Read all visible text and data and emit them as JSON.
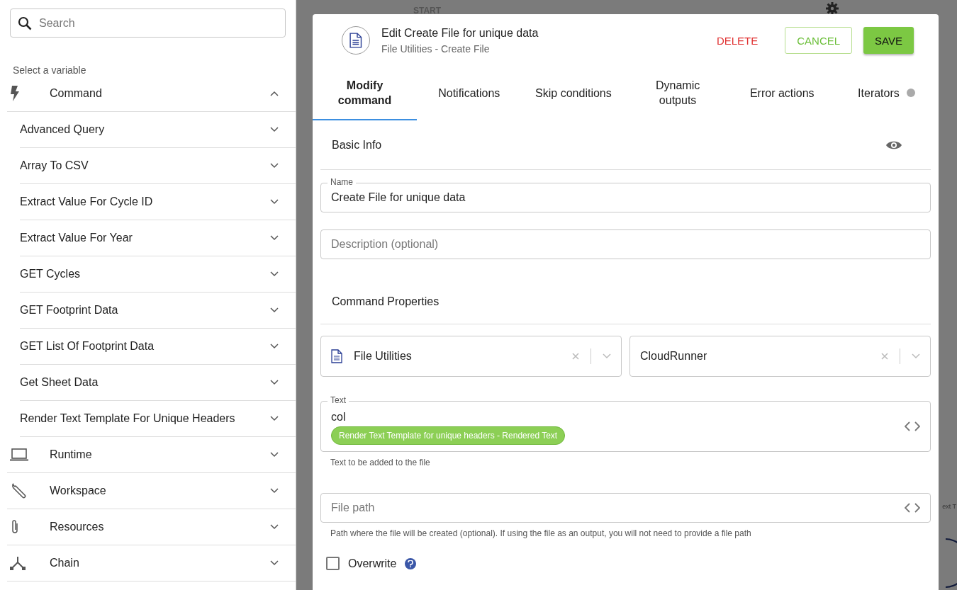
{
  "background": {
    "top_label": "START",
    "side_label": "ext T"
  },
  "sidebar": {
    "search": {
      "placeholder": "Search"
    },
    "hint": "Select a variable",
    "sections": [
      {
        "kind": "command",
        "label": "Command",
        "expanded": true,
        "children": [
          {
            "label": "Advanced Query",
            "expanded": false
          },
          {
            "label": "Array To CSV",
            "expanded": false
          },
          {
            "label": "Extract Value For Cycle ID",
            "expanded": false
          },
          {
            "label": "Extract Value For Year",
            "expanded": false
          },
          {
            "label": "GET Cycles",
            "expanded": false
          },
          {
            "label": "GET Footprint Data",
            "expanded": false
          },
          {
            "label": "GET List Of Footprint Data",
            "expanded": false
          },
          {
            "label": "Get Sheet Data",
            "expanded": false
          },
          {
            "label": "Render Text Template For Unique Headers",
            "expanded": false
          }
        ]
      },
      {
        "kind": "runtime",
        "label": "Runtime",
        "expanded": false
      },
      {
        "kind": "workspace",
        "label": "Workspace",
        "expanded": false
      },
      {
        "kind": "resources",
        "label": "Resources",
        "expanded": false
      },
      {
        "kind": "chain",
        "label": "Chain",
        "expanded": false
      }
    ]
  },
  "modal": {
    "title": "Edit Create File for unique data",
    "subtitle": "File Utilities - Create File",
    "buttons": {
      "delete": "DELETE",
      "cancel": "CANCEL",
      "save": "SAVE"
    },
    "tabs": [
      {
        "label": "Modify command",
        "selected": true
      },
      {
        "label": "Notifications",
        "selected": false
      },
      {
        "label": "Skip conditions",
        "selected": false
      },
      {
        "label": "Dynamic outputs",
        "selected": false
      },
      {
        "label": "Error actions",
        "selected": false
      },
      {
        "label": "Iterators",
        "selected": false,
        "dot": true
      }
    ],
    "basic_info": {
      "heading": "Basic Info",
      "name": {
        "label": "Name",
        "value": "Create File for unique data"
      },
      "description": {
        "placeholder": "Description (optional)"
      }
    },
    "command_properties": {
      "heading": "Command Properties",
      "selects": [
        {
          "value": "File Utilities",
          "icon": true
        },
        {
          "value": "CloudRunner",
          "icon": false
        }
      ],
      "text": {
        "label": "Text",
        "value": "col",
        "chip": "Render Text Template for unique headers - Rendered Text",
        "helper": "Text to be added to the file"
      },
      "file_path": {
        "placeholder": "File path",
        "helper": "Path where the file will be created (optional). If using the file as an output, you will not need to provide a file path"
      },
      "overwrite": {
        "label": "Overwrite",
        "checked": false
      }
    }
  }
}
